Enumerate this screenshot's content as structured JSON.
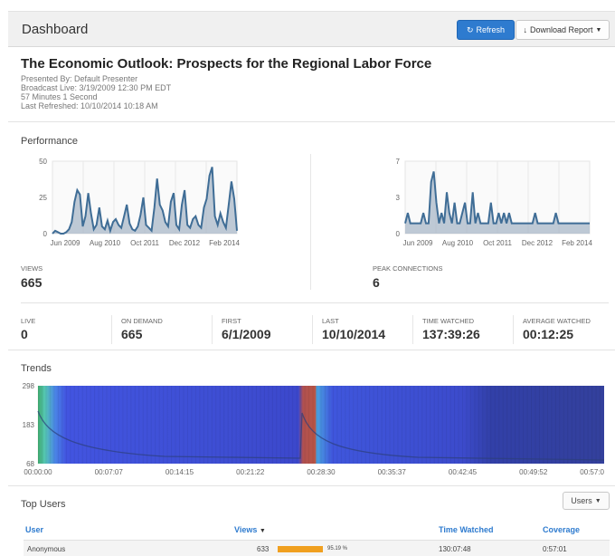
{
  "header": {
    "title": "Dashboard",
    "refresh_label": "Refresh",
    "download_label": "Download Report"
  },
  "event": {
    "title": "The Economic Outlook: Prospects for the Regional Labor Force",
    "presented_by": "Presented By: Default Presenter",
    "broadcast_live": "Broadcast Live: 3/19/2009 12:30 PM EDT",
    "duration": "57 Minutes 1 Second",
    "last_refreshed": "Last Refreshed: 10/10/2014 10:18 AM"
  },
  "performance": {
    "title": "Performance",
    "views_label": "VIEWS",
    "views_value": "665",
    "peak_label": "PEAK CONNECTIONS",
    "peak_value": "6"
  },
  "stats": [
    {
      "label": "LIVE",
      "value": "0"
    },
    {
      "label": "ON DEMAND",
      "value": "665"
    },
    {
      "label": "FIRST",
      "value": "6/1/2009"
    },
    {
      "label": "LAST",
      "value": "10/10/2014"
    },
    {
      "label": "TIME WATCHED",
      "value": "137:39:26"
    },
    {
      "label": "AVERAGE WATCHED",
      "value": "00:12:25"
    }
  ],
  "trends": {
    "title": "Trends"
  },
  "top_users": {
    "title": "Top Users",
    "users_button": "Users",
    "columns": {
      "user": "User",
      "views": "Views",
      "time_watched": "Time Watched",
      "coverage": "Coverage"
    },
    "rows": [
      {
        "user": "Anonymous",
        "views": "633",
        "coverage_pct": "95.19 %",
        "time_watched": "130:07:48",
        "coverage": "0:57:01"
      }
    ]
  },
  "chart_data": [
    {
      "type": "area",
      "y_ticks": [
        "50",
        "25",
        "0"
      ],
      "ylim": [
        0,
        50
      ],
      "x_ticks": [
        "Jun 2009",
        "Aug 2010",
        "Oct 2011",
        "Dec 2012",
        "Feb 2014"
      ],
      "values": [
        0,
        2,
        1,
        0,
        0,
        1,
        3,
        8,
        22,
        30,
        27,
        5,
        12,
        28,
        14,
        3,
        6,
        18,
        5,
        3,
        9,
        2,
        8,
        10,
        6,
        4,
        12,
        20,
        7,
        3,
        2,
        5,
        13,
        25,
        6,
        4,
        2,
        18,
        38,
        20,
        16,
        8,
        5,
        22,
        28,
        6,
        3,
        20,
        30,
        6,
        4,
        10,
        12,
        6,
        4,
        18,
        24,
        40,
        46,
        12,
        6,
        14,
        8,
        4,
        20,
        36,
        24,
        2
      ]
    },
    {
      "type": "area",
      "y_ticks": [
        "7",
        "3",
        "0"
      ],
      "ylim": [
        0,
        7
      ],
      "x_ticks": [
        "Jun 2009",
        "Aug 2010",
        "Oct 2011",
        "Dec 2012",
        "Feb 2014"
      ],
      "values": [
        1,
        2,
        1,
        1,
        1,
        1,
        1,
        2,
        1,
        1,
        5,
        6,
        3,
        1,
        2,
        1,
        4,
        2,
        1,
        3,
        1,
        1,
        2,
        3,
        1,
        1,
        4,
        1,
        2,
        1,
        1,
        1,
        1,
        3,
        1,
        1,
        2,
        1,
        2,
        1,
        2,
        1,
        1,
        1,
        1,
        1,
        1,
        1,
        1,
        1,
        2,
        1,
        1,
        1,
        1,
        1,
        1,
        1,
        2,
        1,
        1,
        1,
        1,
        1,
        1,
        1,
        1,
        1,
        1,
        1,
        1,
        1
      ]
    },
    {
      "type": "heatmap",
      "y_ticks": [
        "298",
        "183",
        "68"
      ],
      "ylim": [
        68,
        298
      ],
      "x_ticks": [
        "00:00:00",
        "00:07:07",
        "00:14:15",
        "00:21:22",
        "00:28:30",
        "00:35:37",
        "00:42:45",
        "00:49:52",
        "00:57:0"
      ]
    }
  ]
}
